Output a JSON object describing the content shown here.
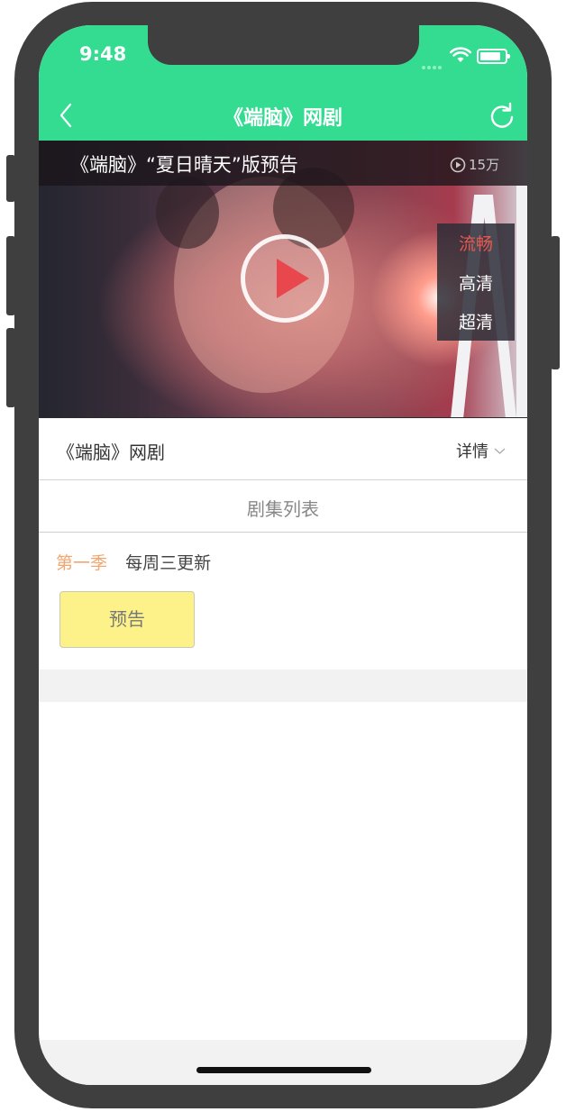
{
  "status_bar": {
    "time": "9:48"
  },
  "navbar": {
    "title": "《端脑》网剧",
    "back_icon": "chevron-left-icon",
    "refresh_icon": "refresh-icon"
  },
  "video": {
    "title": "《端脑》“夏日晴天”版预告",
    "views": "15万",
    "quality_options": [
      {
        "label": "流畅",
        "active": true
      },
      {
        "label": "高清",
        "active": false
      },
      {
        "label": "超清",
        "active": false
      }
    ]
  },
  "info": {
    "show_name": "《端脑》网剧",
    "detail_label": "详情"
  },
  "episodes": {
    "header": "剧集列表",
    "season_label": "第一季",
    "update_note": "每周三更新",
    "items": [
      {
        "label": "预告"
      }
    ]
  },
  "colors": {
    "accent": "#34dc92",
    "season": "#f2a56e",
    "active_quality": "#e6584e",
    "episode_button": "#fdf28a"
  }
}
